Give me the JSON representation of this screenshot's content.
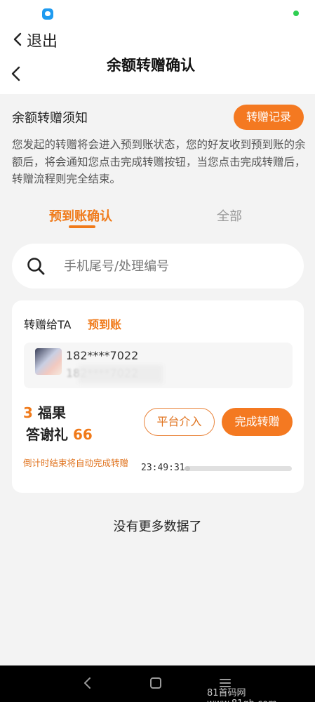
{
  "status_bar": {
    "app_icon": "chat-bubble-icon",
    "indicator_color": "#2fcf52"
  },
  "outer_nav": {
    "back_label": "退出"
  },
  "inner_nav": {
    "title": "余额转赠确认"
  },
  "notice": {
    "title": "余额转赠须知",
    "records_button": "转赠记录",
    "body": "您发起的转赠将会进入预到账状态，您的好友收到预到账的余额后，将会通知您点击完成转赠按钮，当您点击完成转赠后，转赠流程则完全结束。"
  },
  "tabs": [
    {
      "label": "预到账确认",
      "active": true
    },
    {
      "label": "全部",
      "active": false
    }
  ],
  "search": {
    "placeholder": "手机尾号/处理编号",
    "value": ""
  },
  "card": {
    "to_label": "转赠给TA",
    "status": "预到账",
    "phone": "182****7022",
    "phone_secondary": "182****7022",
    "reward_count": "3",
    "reward_unit": "福果",
    "thanks_label": "答谢礼",
    "thanks_value": "66",
    "platform_button": "平台介入",
    "complete_button": "完成转赠",
    "countdown_note": "倒计时结束将自动完成转赠",
    "countdown_time": "23:49:31",
    "countdown_progress": 0.05
  },
  "footer": {
    "no_more": "没有更多数据了"
  },
  "watermark": "81首码网www.81qh.com",
  "colors": {
    "accent": "#f47921",
    "accent_text": "#f07a1a",
    "background": "#f3f3f3"
  }
}
